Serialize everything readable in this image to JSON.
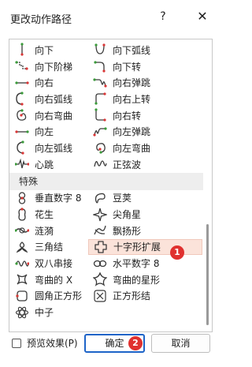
{
  "window": {
    "title": "更改动作路径",
    "help_label": "?",
    "close_label": "✕"
  },
  "rows": [
    {
      "left": {
        "label": "向下",
        "icon": "path-down-icon"
      },
      "right": {
        "label": "向下弧线",
        "icon": "path-arc-down-icon"
      }
    },
    {
      "left": {
        "label": "向下阶梯",
        "icon": "path-stairs-down-icon"
      },
      "right": {
        "label": "向下转",
        "icon": "path-turn-down-icon"
      }
    },
    {
      "left": {
        "label": "向右",
        "icon": "path-right-icon"
      },
      "right": {
        "label": "向右弹跳",
        "icon": "path-bounce-right-icon"
      }
    },
    {
      "left": {
        "label": "向右弧线",
        "icon": "path-arc-right-icon"
      },
      "right": {
        "label": "向右上转",
        "icon": "path-turn-up-right-icon"
      }
    },
    {
      "left": {
        "label": "向右弯曲",
        "icon": "path-curvy-right-icon"
      },
      "right": {
        "label": "向右转",
        "icon": "path-turn-right-icon"
      }
    },
    {
      "left": {
        "label": "向左",
        "icon": "path-left-icon"
      },
      "right": {
        "label": "向左弹跳",
        "icon": "path-bounce-left-icon"
      }
    },
    {
      "left": {
        "label": "向左弧线",
        "icon": "path-arc-left-icon"
      },
      "right": {
        "label": "向左弯曲",
        "icon": "path-curvy-left-icon"
      }
    },
    {
      "left": {
        "label": "心跳",
        "icon": "path-heartbeat-icon"
      },
      "right": {
        "label": "正弦波",
        "icon": "path-sine-wave-icon"
      }
    }
  ],
  "section": {
    "label": "特殊"
  },
  "special_rows": [
    {
      "left": {
        "label": "垂直数字 8",
        "icon": "path-vertical-eight-icon"
      },
      "right": {
        "label": "豆荚",
        "icon": "path-bean-icon"
      }
    },
    {
      "left": {
        "label": "花生",
        "icon": "path-peanut-icon"
      },
      "right": {
        "label": "尖角星",
        "icon": "path-pointy-star-icon"
      }
    },
    {
      "left": {
        "label": "涟漪",
        "icon": "path-swoosh-icon"
      },
      "right": {
        "label": "飘扬形",
        "icon": "path-curved-x-flag-icon"
      }
    },
    {
      "left": {
        "label": "三角结",
        "icon": "path-loop-triangle-icon"
      },
      "right": {
        "label": "十字形扩展",
        "icon": "path-plus-expand-icon",
        "selected": true
      }
    },
    {
      "left": {
        "label": "双八串接",
        "icon": "path-double-eight-icon"
      },
      "right": {
        "label": "水平数字 8",
        "icon": "path-horizontal-eight-icon"
      }
    },
    {
      "left": {
        "label": "弯曲的 X",
        "icon": "path-curvy-x-icon"
      },
      "right": {
        "label": "弯曲的星形",
        "icon": "path-curvy-star-icon"
      }
    },
    {
      "left": {
        "label": "圆角正方形",
        "icon": "path-rounded-square-icon"
      },
      "right": {
        "label": "正方形结",
        "icon": "path-square-knot-icon"
      }
    },
    {
      "left": {
        "label": "中子",
        "icon": "path-neutron-icon"
      }
    }
  ],
  "annotations": {
    "badge_1": "1",
    "badge_2": "2"
  },
  "footer": {
    "preview_label": "预览效果(P)",
    "preview_checked": false,
    "ok_label": "确定",
    "cancel_label": "取消"
  },
  "colors": {
    "path_green": "#3a9a3a",
    "path_red": "#d93636",
    "selected_bg": "#fbe3da",
    "badge": "#e0312f",
    "ok_border": "#1e64c8"
  }
}
